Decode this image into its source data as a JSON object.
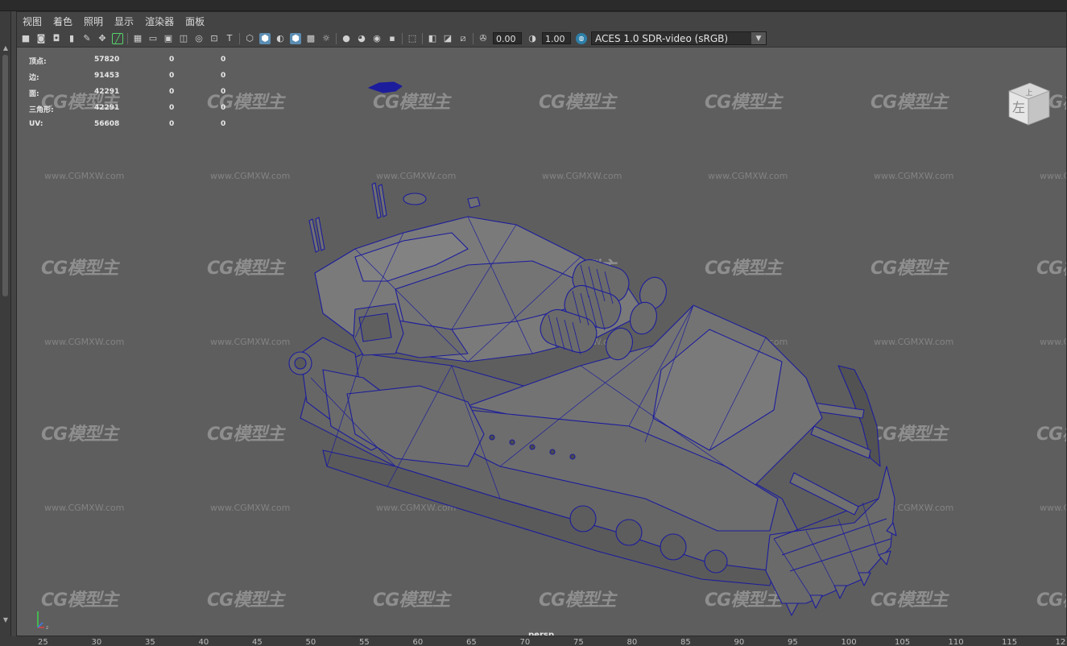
{
  "menu": [
    "视图",
    "着色",
    "照明",
    "显示",
    "渲染器",
    "面板"
  ],
  "toolbar": {
    "exposure_value": "0.00",
    "gamma_value": "1.00",
    "colorspace": "ACES 1.0 SDR-video (sRGB)"
  },
  "hud": {
    "rows": [
      {
        "label": "顶点:",
        "v1": "57820",
        "v2": "0",
        "v3": "0"
      },
      {
        "label": "边:",
        "v1": "91453",
        "v2": "0",
        "v3": "0"
      },
      {
        "label": "面:",
        "v1": "42291",
        "v2": "0",
        "v3": "0"
      },
      {
        "label": "三角形:",
        "v1": "42291",
        "v2": "0",
        "v3": "0"
      },
      {
        "label": "UV:",
        "v1": "56608",
        "v2": "0",
        "v3": "0"
      }
    ]
  },
  "viewcube": {
    "face_label": "左",
    "top_label": "上"
  },
  "camera_label": "persp",
  "watermark": {
    "logo": "CG模型主",
    "url": "www.CGMXW.com"
  },
  "ruler": [
    "25",
    "30",
    "35",
    "40",
    "45",
    "50",
    "55",
    "60",
    "65",
    "70",
    "75",
    "80",
    "85",
    "90",
    "95",
    "100",
    "105",
    "110",
    "115",
    "12"
  ],
  "colors": {
    "wireframe": "#1c1d9c",
    "viewport_bg": "#5e5e5e",
    "mesh_fill": "#6f6f6f"
  }
}
